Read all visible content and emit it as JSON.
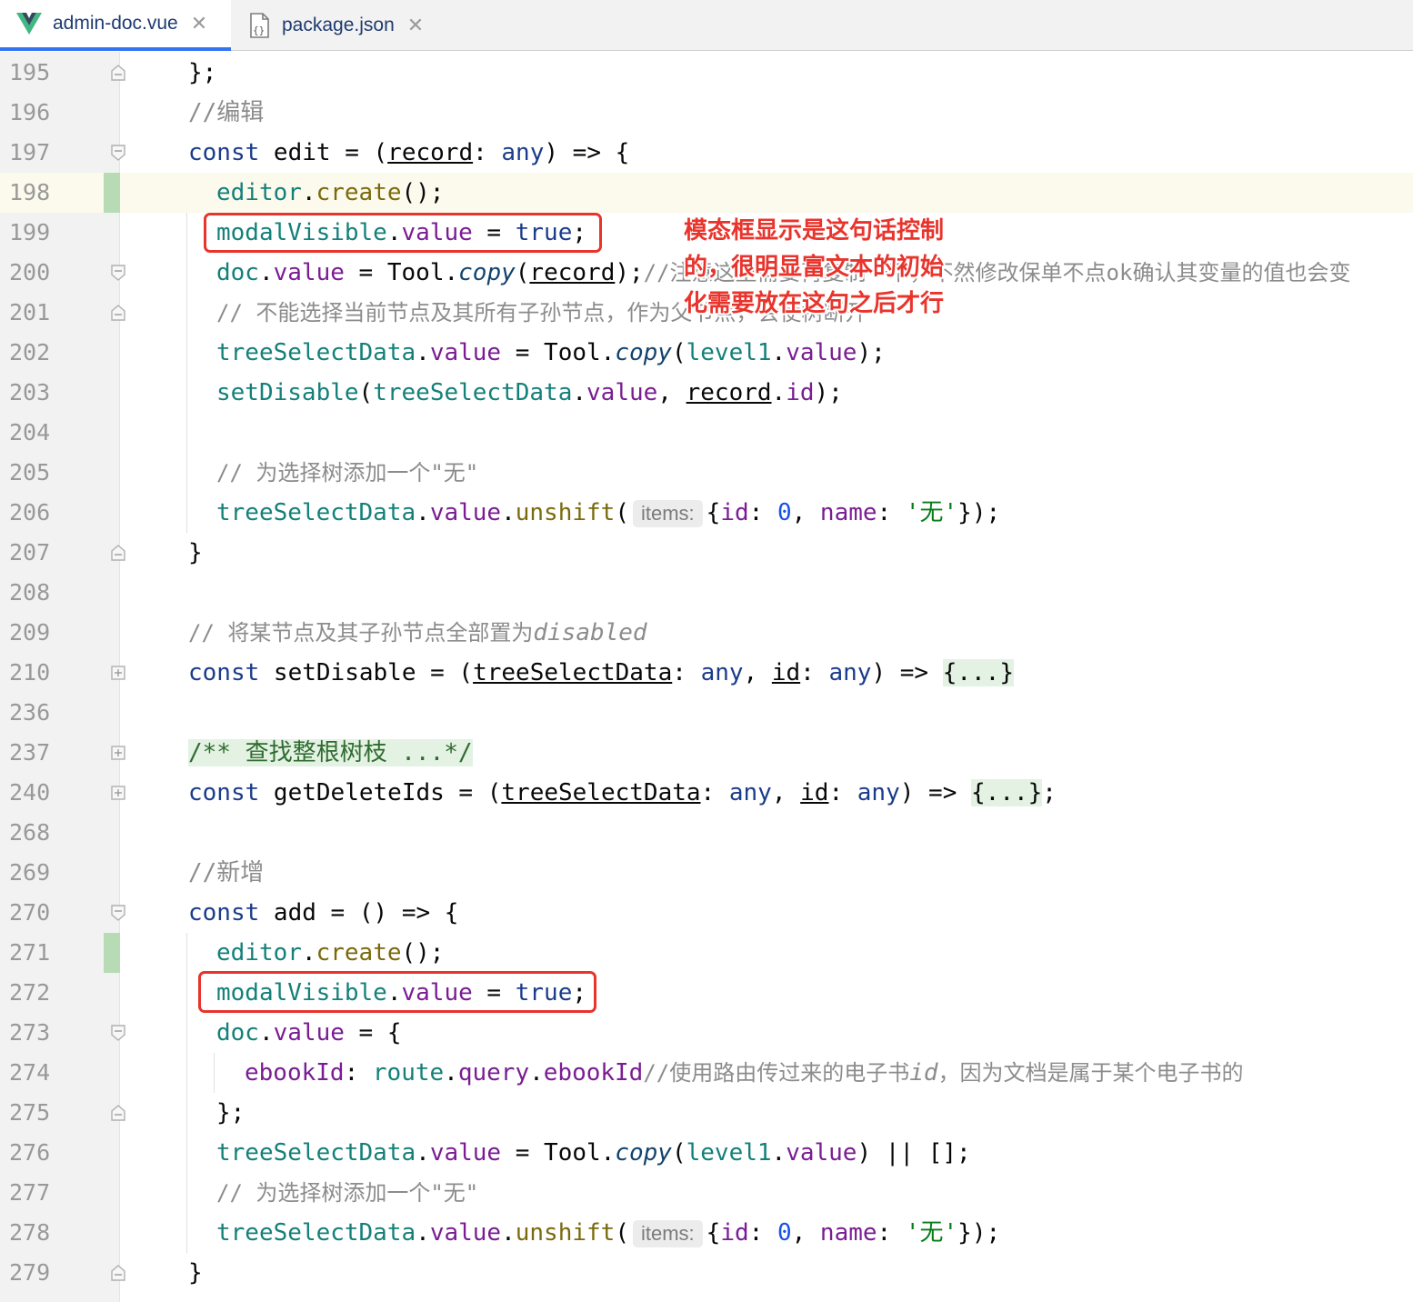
{
  "tabs": [
    {
      "label": "admin-doc.vue",
      "icon": "vue-logo-icon",
      "active": true
    },
    {
      "label": "package.json",
      "icon": "json-file-icon",
      "active": false
    }
  ],
  "lines": {
    "l195": {
      "num": "195",
      "t1": "};"
    },
    "l196": {
      "num": "196",
      "t1": "//编辑"
    },
    "l197": {
      "num": "197",
      "t1": "const",
      "t2": " edit = (",
      "t3": "record",
      "t4": ": ",
      "t5": "any",
      "t6": ") => {"
    },
    "l198": {
      "num": "198",
      "t1": "editor",
      "t2": ".",
      "t3": "create",
      "t4": "();"
    },
    "l199": {
      "num": "199",
      "t1": "modalVisible",
      "t2": ".",
      "t3": "value",
      "t4": " = ",
      "t5": "true",
      "t6": ";"
    },
    "l200": {
      "num": "200",
      "t1": "doc",
      "t2": ".",
      "t3": "value",
      "t4": " = Tool.",
      "t5": "copy",
      "t6": "(",
      "t7": "record",
      "t8": ");",
      "t9": "//注意这里需要再复制一下，不然修改保单不点ok确认其变量的值也会变"
    },
    "l201": {
      "num": "201",
      "t1": "// 不能选择当前节点及其所有子孙节点，作为父节点，会使树断开"
    },
    "l202": {
      "num": "202",
      "t1": "treeSelectData",
      "t2": ".",
      "t3": "value",
      "t4": " = Tool.",
      "t5": "copy",
      "t6": "(",
      "t7": "level1",
      "t8": ".",
      "t9": "value",
      "t10": ");"
    },
    "l203": {
      "num": "203",
      "t1": "setDisable",
      "t2": "(",
      "t3": "treeSelectData",
      "t4": ".",
      "t5": "value",
      "t6": ", ",
      "t7": "record",
      "t8": ".",
      "t9": "id",
      "t10": ");"
    },
    "l204": {
      "num": "204"
    },
    "l205": {
      "num": "205",
      "t1": "// 为选择树添加一个\"无\""
    },
    "l206": {
      "num": "206",
      "t1": "treeSelectData",
      "t2": ".",
      "t3": "value",
      "t4": ".",
      "t5": "unshift",
      "t6": "(",
      "hint": "items:",
      "t7": "{",
      "t8": "id",
      "t9": ": ",
      "t10": "0",
      "t11": ", ",
      "t12": "name",
      "t13": ": ",
      "t14": "'无'",
      "t15": "});"
    },
    "l207": {
      "num": "207",
      "t1": "}"
    },
    "l208": {
      "num": "208"
    },
    "l209": {
      "num": "209",
      "t1": "// 将某节点及其子孙节点全部置为",
      "t2": "disabled"
    },
    "l210": {
      "num": "210",
      "t1": "const",
      "t2": " setDisable = (",
      "t3": "treeSelectData",
      "t4": ": ",
      "t5": "any",
      "t6": ", ",
      "t7": "id",
      "t8": ": ",
      "t9": "any",
      "t10": ") => ",
      "t11": "{...}"
    },
    "l236": {
      "num": "236"
    },
    "l237": {
      "num": "237",
      "t1": "/** 查找整根树枝 ...*/"
    },
    "l240": {
      "num": "240",
      "t1": "const",
      "t2": " getDeleteIds = (",
      "t3": "treeSelectData",
      "t4": ": ",
      "t5": "any",
      "t6": ", ",
      "t7": "id",
      "t8": ": ",
      "t9": "any",
      "t10": ") => ",
      "t11": "{...}",
      "t12": ";"
    },
    "l268": {
      "num": "268"
    },
    "l269": {
      "num": "269",
      "t1": "//新增"
    },
    "l270": {
      "num": "270",
      "t1": "const",
      "t2": " add = () => {"
    },
    "l271": {
      "num": "271",
      "t1": "editor",
      "t2": ".",
      "t3": "create",
      "t4": "();"
    },
    "l272": {
      "num": "272",
      "t1": "modalVisible",
      "t2": ".",
      "t3": "value",
      "t4": " = ",
      "t5": "true",
      "t6": ";"
    },
    "l273": {
      "num": "273",
      "t1": "doc",
      "t2": ".",
      "t3": "value",
      "t4": " = {"
    },
    "l274": {
      "num": "274",
      "t1": "ebookId",
      "t2": ": ",
      "t3": "route",
      "t4": ".",
      "t5": "query",
      "t6": ".",
      "t7": "ebookId",
      "t8": "//使用路由传过来的电子书",
      "t9": "id",
      "t10": "，因为文档是属于某个电子书的"
    },
    "l275": {
      "num": "275",
      "t1": "};"
    },
    "l276": {
      "num": "276",
      "t1": "treeSelectData",
      "t2": ".",
      "t3": "value",
      "t4": " = Tool.",
      "t5": "copy",
      "t6": "(",
      "t7": "level1",
      "t8": ".",
      "t9": "value",
      "t10": ") || [];"
    },
    "l277": {
      "num": "277",
      "t1": "// 为选择树添加一个\"无\""
    },
    "l278": {
      "num": "278",
      "t1": "treeSelectData",
      "t2": ".",
      "t3": "value",
      "t4": ".",
      "t5": "unshift",
      "t6": "(",
      "hint": "items:",
      "t7": "{",
      "t8": "id",
      "t9": ": ",
      "t10": "0",
      "t11": ", ",
      "t12": "name",
      "t13": ": ",
      "t14": "'无'",
      "t15": "});"
    },
    "l279": {
      "num": "279",
      "t1": "}"
    }
  },
  "annotation": {
    "text": "模态框显示是这句话控制的，很明显富文本的初始化需要放在这句之后才行",
    "color": "#e8342c"
  },
  "colors": {
    "keyword": "#1b3c8c",
    "variable": "#14807a",
    "property": "#7a1d93",
    "method": "#7a6a0c",
    "string": "#067d17",
    "number": "#1750eb",
    "comment": "#8c8c8c",
    "highlight_line": "#fcfaed",
    "change_marker": "#b7dcb5",
    "annotation_red": "#e8342c"
  }
}
